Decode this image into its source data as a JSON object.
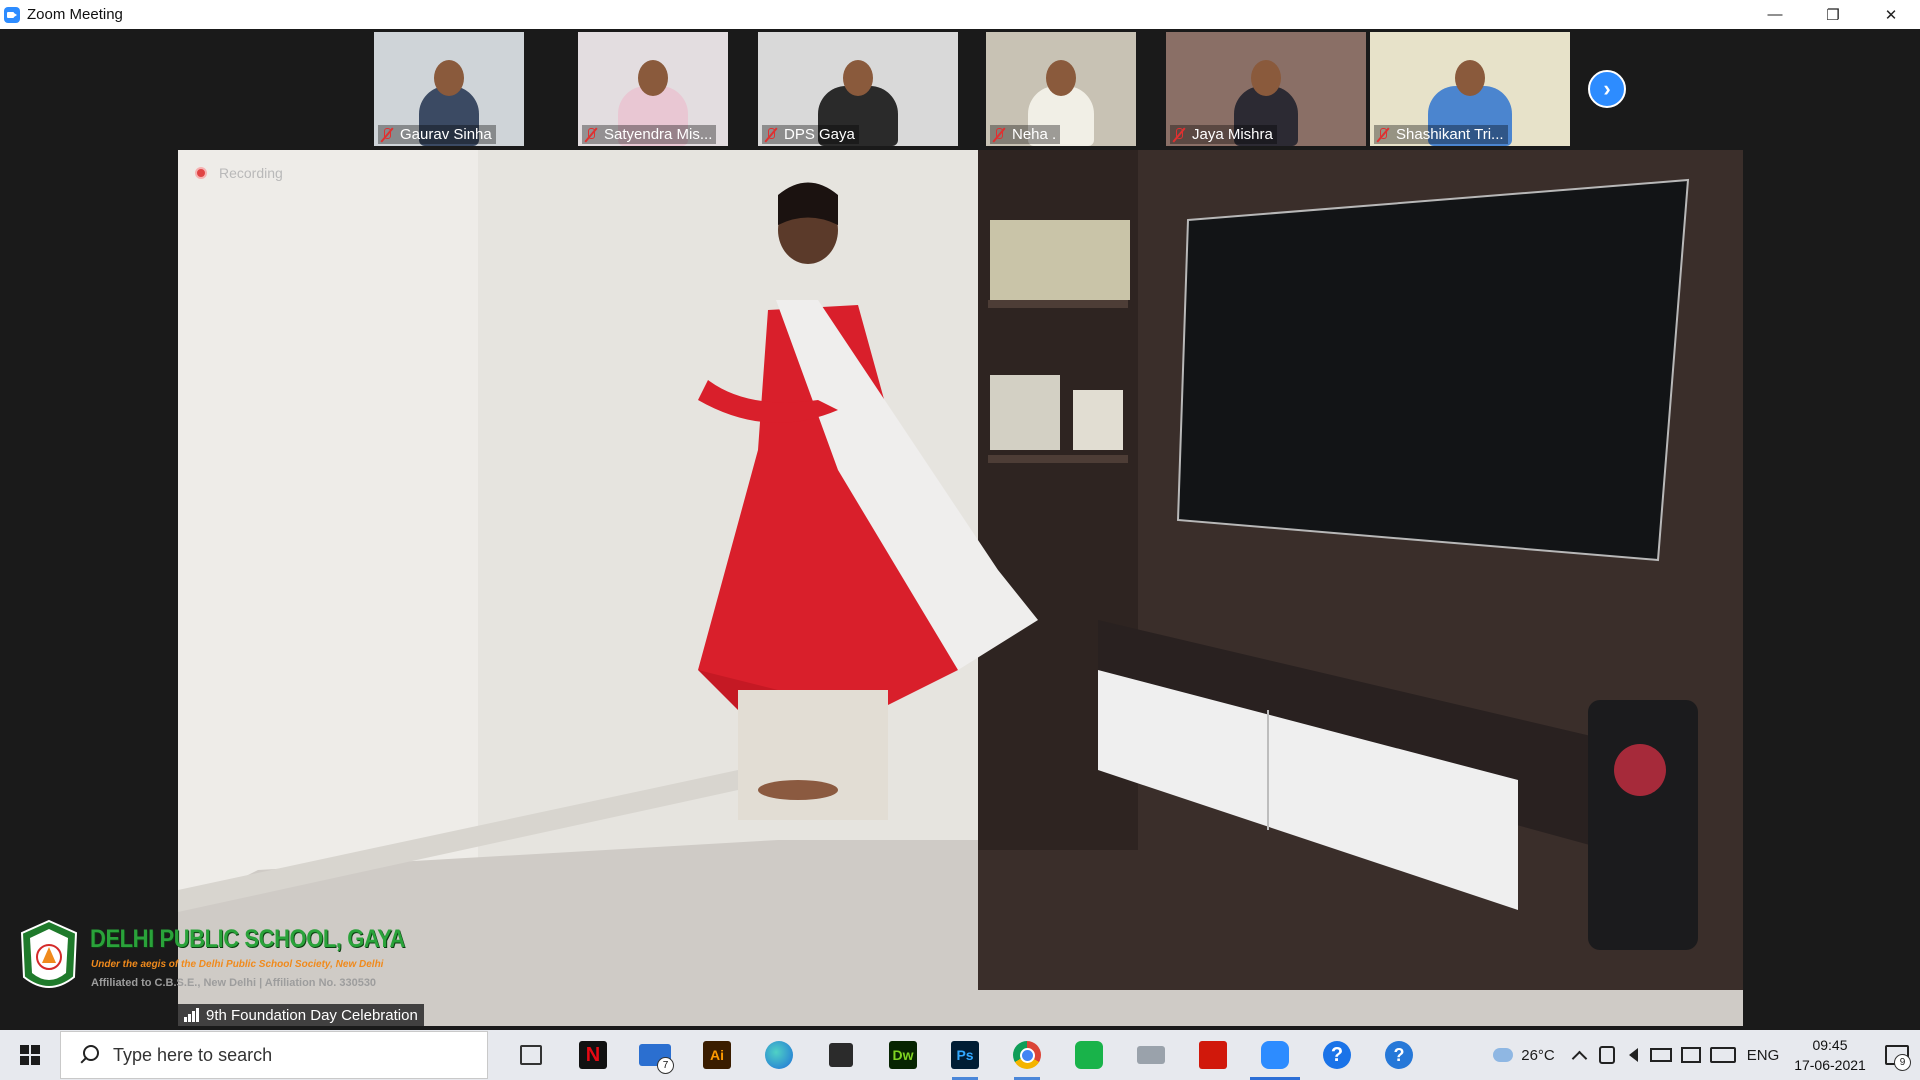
{
  "window": {
    "title": "Zoom Meeting",
    "minimize": "—",
    "restore": "❐",
    "close": "✕"
  },
  "participants": [
    {
      "name": "Gaurav Sinha",
      "bg": "#cfd4d8",
      "shirt": "#3b4a63"
    },
    {
      "name": "Satyendra Mis...",
      "bg": "#e3dde0",
      "shirt": "#e9c7d3"
    },
    {
      "name": "DPS Gaya",
      "bg": "#d9d9d9",
      "shirt": "#2a2a2a"
    },
    {
      "name": "Neha .",
      "bg": "#c8c2b4",
      "shirt": "#f1efe6"
    },
    {
      "name": "Jaya Mishra",
      "bg": "#8a6f66",
      "shirt": "#2c2a33"
    },
    {
      "name": "Shashikant Tri...",
      "bg": "#e7e2c9",
      "shirt": "#4b85cf"
    }
  ],
  "next_button": "›",
  "recording": {
    "label": "Recording"
  },
  "school": {
    "name": "DELHI PUBLIC SCHOOL, GAYA",
    "aegis": "Under the aegis of the Delhi Public School Society, New Delhi",
    "affiliation": "Affiliated to C.B.S.E., New Delhi | Affiliation No. 330530"
  },
  "caption": "9th Foundation Day Celebration",
  "taskbar": {
    "search_placeholder": "Type here to search",
    "apps": [
      {
        "icon": "task-view-icon"
      },
      {
        "icon": "netflix-icon",
        "glyph": "N"
      },
      {
        "icon": "mail-icon",
        "badge": "7"
      },
      {
        "icon": "illustrator-icon",
        "glyph": "Ai"
      },
      {
        "icon": "edge-icon"
      },
      {
        "icon": "store-icon"
      },
      {
        "icon": "dreamweaver-icon",
        "glyph": "Dw"
      },
      {
        "icon": "photoshop-icon",
        "glyph": "Ps"
      },
      {
        "icon": "chrome-icon"
      },
      {
        "icon": "phone-app-icon"
      },
      {
        "icon": "printer-icon"
      },
      {
        "icon": "acrobat-icon"
      },
      {
        "icon": "zoom-icon"
      },
      {
        "icon": "help-icon",
        "glyph": "?"
      },
      {
        "icon": "quick-assist-icon",
        "glyph": "?"
      }
    ],
    "weather": "26°C",
    "language": "ENG",
    "time": "09:45",
    "date": "17-06-2021",
    "notifications": "9"
  },
  "colors": {
    "accent": "#2d8cff",
    "mute": "#e03030",
    "school_green": "#2aa33a",
    "school_orange": "#f08a1c"
  }
}
